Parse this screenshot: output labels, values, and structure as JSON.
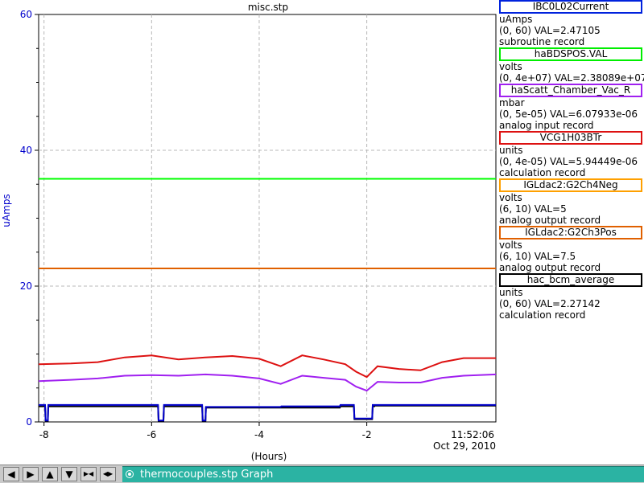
{
  "chart_data": {
    "type": "line",
    "title": "misc.stp",
    "xlabel": "(Hours)",
    "ylabel": "uAmps",
    "xlim": [
      -8.1,
      0.4
    ],
    "ylim": [
      0,
      60
    ],
    "x_ticks": [
      "-8",
      "-6",
      "-4",
      "-2"
    ],
    "y_ticks": [
      "0",
      "20",
      "40",
      "60"
    ],
    "grid": true,
    "time_label": "11:52:06",
    "date_label": "Oct 29, 2010",
    "series": [
      {
        "name": "haBDSPOS.VAL",
        "color": "#00ff00",
        "x": [
          -8.1,
          0.4
        ],
        "y": [
          35.8,
          35.8
        ]
      },
      {
        "name": "IGLdac2:G2Ch3Pos",
        "color": "#e06000",
        "x": [
          -8.1,
          0.4
        ],
        "y": [
          22.6,
          22.6
        ]
      },
      {
        "name": "VCG1H03BTr",
        "color": "#dd1111",
        "x": [
          -8.1,
          -7.5,
          -7.0,
          -6.5,
          -6.0,
          -5.5,
          -5.0,
          -4.5,
          -4.0,
          -3.6,
          -3.2,
          -2.8,
          -2.4,
          -2.2,
          -2.0,
          -1.8,
          -1.4,
          -1.0,
          -0.6,
          -0.2,
          0.4
        ],
        "y": [
          8.5,
          8.6,
          8.8,
          9.5,
          9.8,
          9.2,
          9.5,
          9.7,
          9.3,
          8.2,
          9.8,
          9.2,
          8.5,
          7.4,
          6.6,
          8.2,
          7.8,
          7.6,
          8.8,
          9.4,
          9.4
        ]
      },
      {
        "name": "haScatt_Chamber_Vac_R",
        "color": "#a020f0",
        "x": [
          -8.1,
          -7.5,
          -7.0,
          -6.5,
          -6.0,
          -5.5,
          -5.0,
          -4.5,
          -4.0,
          -3.6,
          -3.2,
          -2.8,
          -2.4,
          -2.2,
          -2.0,
          -1.8,
          -1.4,
          -1.0,
          -0.6,
          -0.2,
          0.4
        ],
        "y": [
          6.0,
          6.2,
          6.4,
          6.8,
          6.9,
          6.8,
          7.0,
          6.8,
          6.4,
          5.6,
          6.8,
          6.5,
          6.2,
          5.2,
          4.6,
          5.9,
          5.8,
          5.8,
          6.5,
          6.8,
          7.0
        ]
      },
      {
        "name": "hac_bcm_average",
        "color": "#000000",
        "x": [
          -8.1,
          -7.98,
          -7.97,
          -7.93,
          -7.92,
          -5.88,
          -5.87,
          -5.78,
          -5.77,
          -5.06,
          -5.05,
          -5.0,
          -4.99,
          -3.6,
          -3.59,
          -2.5,
          -2.49,
          -2.24,
          -2.23,
          -1.9,
          -1.89,
          -1.86,
          -1.85,
          0.4
        ],
        "y": [
          2.3,
          2.3,
          0.1,
          0.1,
          2.3,
          2.3,
          0.1,
          0.1,
          2.3,
          2.3,
          0.1,
          0.1,
          2.1,
          2.1,
          2.1,
          2.1,
          2.3,
          2.3,
          0.4,
          0.4,
          2.3,
          2.3,
          2.4,
          2.4
        ]
      },
      {
        "name": "IBC0L02Current",
        "color": "#0000cc",
        "x": [
          -8.1,
          -7.98,
          -7.97,
          -7.93,
          -7.92,
          -5.88,
          -5.87,
          -5.78,
          -5.77,
          -5.06,
          -5.05,
          -5.0,
          -4.99,
          -3.6,
          -3.59,
          -2.5,
          -2.49,
          -2.24,
          -2.23,
          -1.9,
          -1.89,
          -1.86,
          -1.85,
          0.4
        ],
        "y": [
          2.5,
          2.5,
          0.2,
          0.2,
          2.5,
          2.5,
          0.2,
          0.2,
          2.5,
          2.5,
          0.2,
          0.2,
          2.2,
          2.2,
          2.3,
          2.3,
          2.5,
          2.5,
          0.5,
          0.5,
          2.5,
          2.5,
          2.5,
          2.5
        ]
      }
    ]
  },
  "legend": [
    {
      "name": "IBC0L02Current",
      "color": "#0022dd",
      "units": "uAmps",
      "range": "(0, 60) VAL=2.47105",
      "record": "subroutine record"
    },
    {
      "name": "haBDSPOS.VAL",
      "color": "#00ee00",
      "units": "volts",
      "range": "(0, 4e+07) VAL=2.38089e+07",
      "record": ""
    },
    {
      "name": "haScatt_Chamber_Vac_R",
      "color": "#a020f0",
      "units": "mbar",
      "range": "(0, 5e-05) VAL=6.07933e-06",
      "record": "analog input record"
    },
    {
      "name": "VCG1H03BTr",
      "color": "#dd1111",
      "units": "units",
      "range": "(0, 4e-05) VAL=5.94449e-06",
      "record": "calculation record"
    },
    {
      "name": "IGLdac2:G2Ch4Neg",
      "color": "#ffa000",
      "units": "volts",
      "range": "(6, 10) VAL=5",
      "record": "analog output record"
    },
    {
      "name": "IGLdac2:G2Ch3Pos",
      "color": "#e06000",
      "units": "volts",
      "range": "(6, 10) VAL=7.5",
      "record": "analog output record"
    },
    {
      "name": "hac_bcm_average",
      "color": "#000000",
      "units": "units",
      "range": "(0, 60) VAL=2.27142",
      "record": "calculation record"
    }
  ],
  "toolbar": {
    "buttons": [
      {
        "name": "scroll-left-button",
        "glyph": "◀"
      },
      {
        "name": "scroll-right-button",
        "glyph": "▶"
      },
      {
        "name": "scroll-up-button",
        "glyph": "▲"
      },
      {
        "name": "scroll-down-button",
        "glyph": "▼"
      },
      {
        "name": "zoom-in-button",
        "glyph": "▶◀"
      },
      {
        "name": "zoom-out-button",
        "glyph": "◀▶"
      }
    ],
    "tab_label": "thermocouples.stp Graph"
  }
}
